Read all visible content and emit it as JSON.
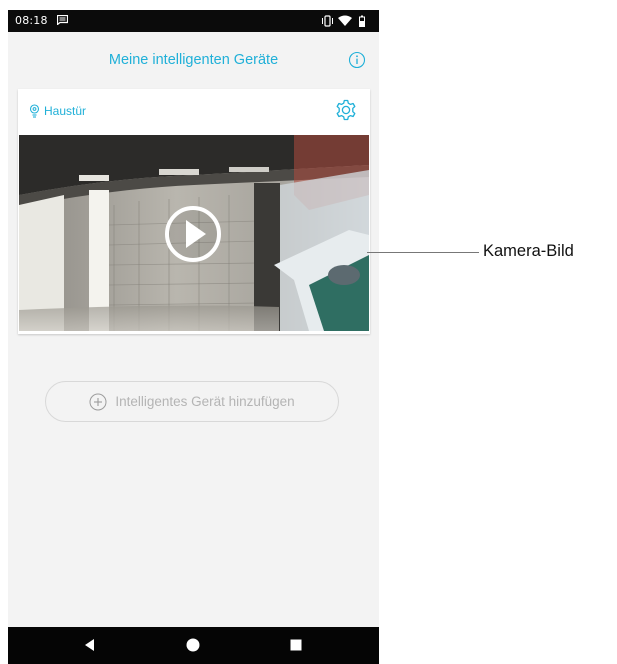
{
  "status_bar": {
    "time": "08:18",
    "icons": [
      "message-icon",
      "vibrate-icon",
      "wifi-icon",
      "battery-icon"
    ]
  },
  "header": {
    "title": "Meine intelligenten Geräte",
    "info_icon": "info-icon"
  },
  "device": {
    "name": "Haustür",
    "location_icon": "bulb-pin-icon",
    "settings_icon": "gear-icon",
    "preview_icon": "play-icon"
  },
  "add_device": {
    "label": "Intelligentes Gerät hinzufügen",
    "icon": "plus-circle-icon"
  },
  "nav": {
    "buttons": [
      "back-icon",
      "home-icon",
      "recents-icon"
    ]
  },
  "annotation": {
    "label": "Kamera-Bild"
  },
  "colors": {
    "accent": "#20b0d8",
    "background": "#f3f3f3",
    "bar": "#0b0b0b"
  }
}
